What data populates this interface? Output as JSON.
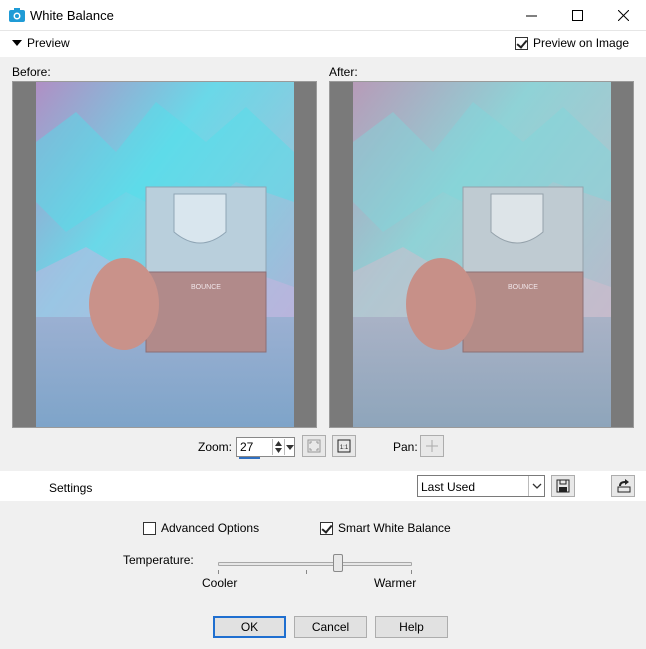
{
  "window": {
    "title": "White Balance"
  },
  "preview": {
    "toggle_label": "Preview",
    "preview_on_image_label": "Preview on Image",
    "preview_on_image_checked": true
  },
  "panes": {
    "before_label": "Before:",
    "after_label": "After:"
  },
  "zoom": {
    "label": "Zoom:",
    "value": "27"
  },
  "pan": {
    "label": "Pan:"
  },
  "settings": {
    "label": "Settings",
    "preset_value": "Last Used"
  },
  "options": {
    "advanced_label": "Advanced Options",
    "advanced_checked": false,
    "smart_wb_label": "Smart White Balance",
    "smart_wb_checked": true
  },
  "temperature": {
    "label": "Temperature:",
    "min_label": "Cooler",
    "max_label": "Warmer",
    "position_fraction": 0.62
  },
  "buttons": {
    "ok": "OK",
    "cancel": "Cancel",
    "help": "Help"
  },
  "product": {
    "brand": "BOUNCE"
  },
  "icons": [
    "camera-icon",
    "minimize-icon",
    "maximize-icon",
    "close-icon",
    "chevron-down-icon",
    "fit-zoom-icon",
    "actual-size-icon",
    "pan-icon",
    "save-icon",
    "reset-icon"
  ]
}
